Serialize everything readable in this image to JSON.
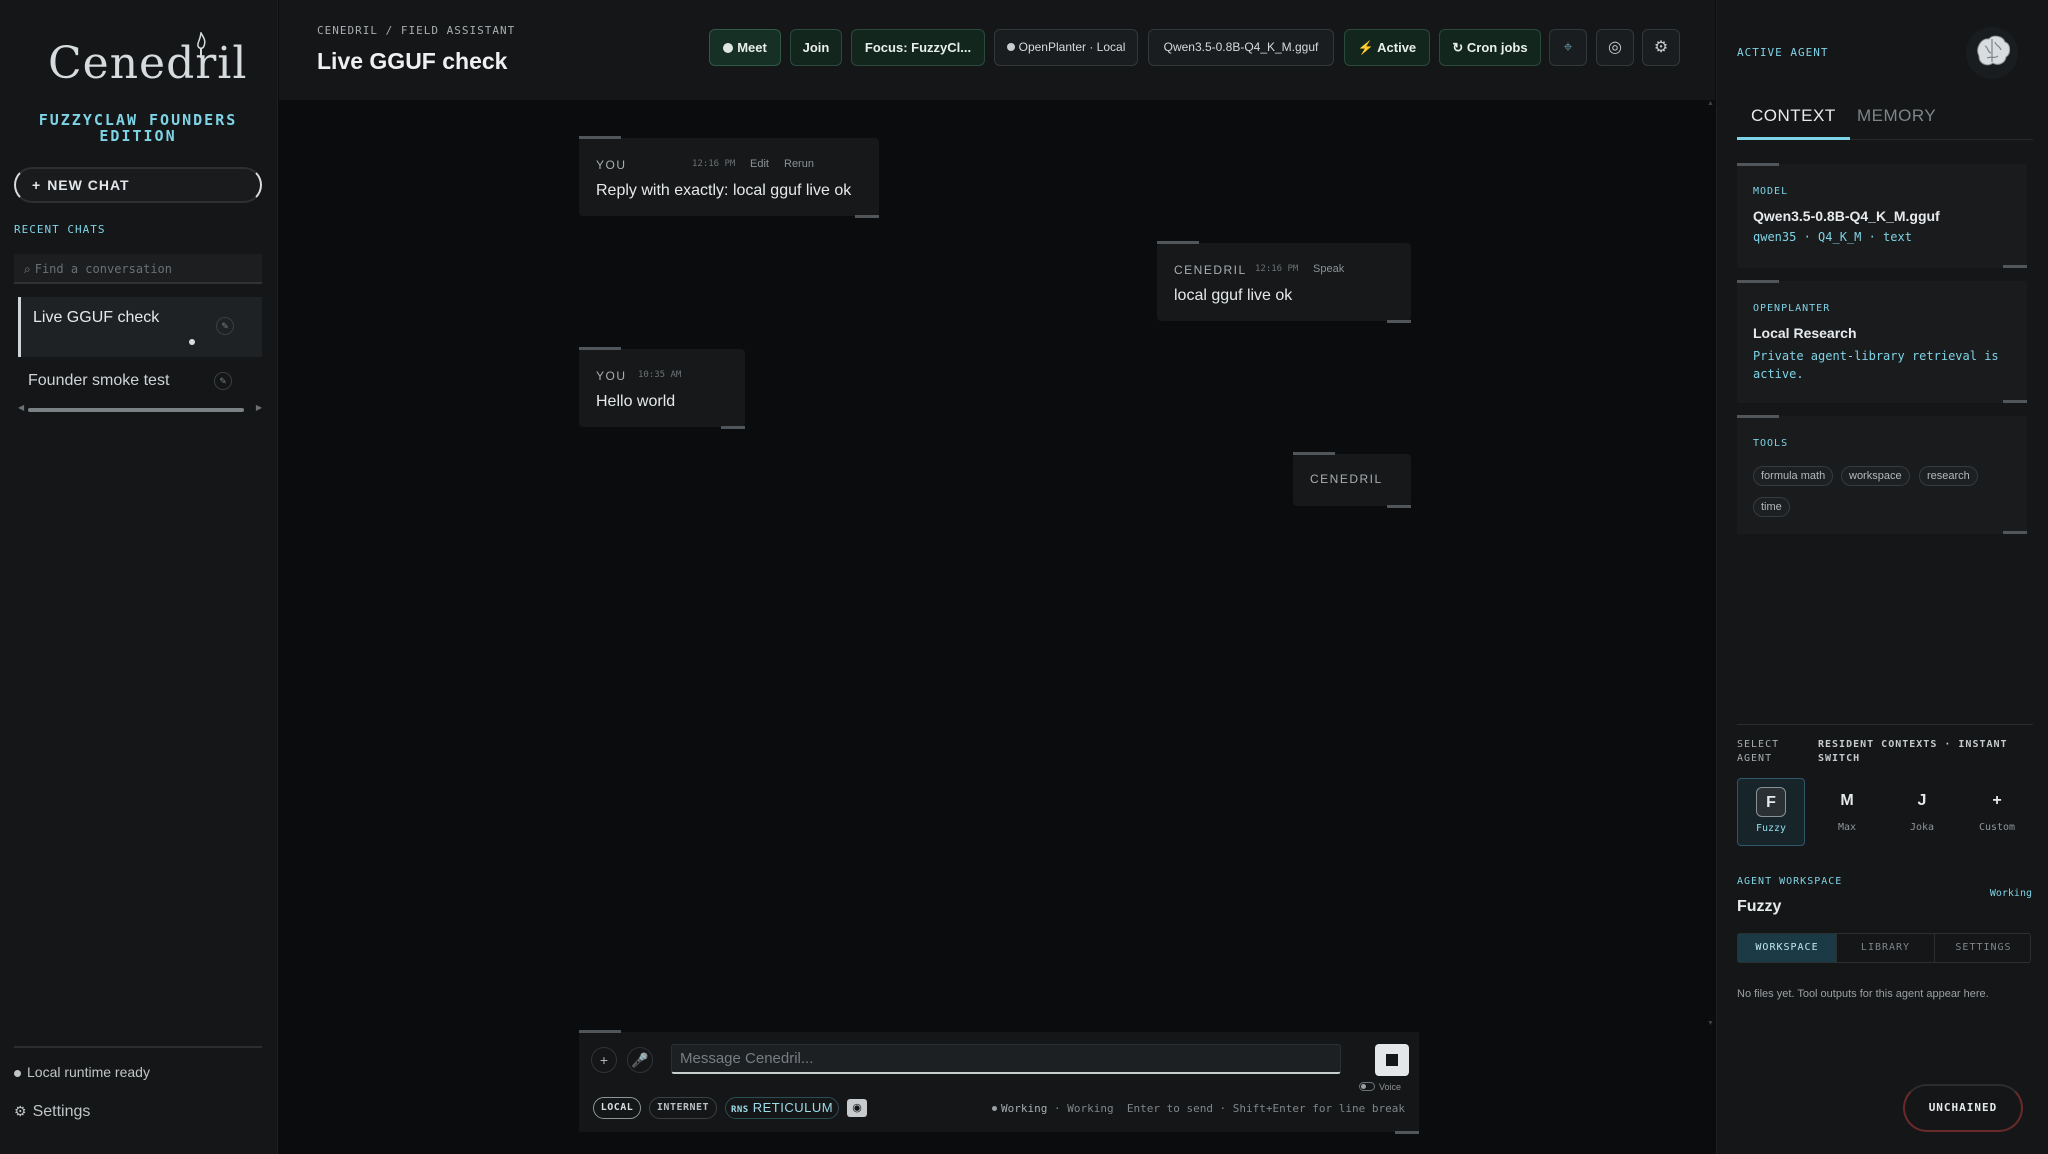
{
  "sidebar": {
    "logo_text": "Cenedril",
    "brand": "FUZZYCLAW FOUNDERS EDITION",
    "new_chat_label": "NEW CHAT",
    "recent_label": "RECENT CHATS",
    "search_placeholder": "Find a conversation",
    "chats": [
      {
        "title": "Live GGUF check"
      },
      {
        "title": "Founder smoke test"
      }
    ],
    "runtime_status": "Local runtime ready",
    "settings_label": "Settings"
  },
  "header": {
    "breadcrumb": "CENEDRIL / FIELD ASSISTANT",
    "title": "Live GGUF check",
    "buttons": {
      "meet": "Meet",
      "join": "Join",
      "focus": "Focus: FuzzyCl...",
      "openplanter": "OpenPlanter · Local",
      "model": "Qwen3.5-0.8B-Q4_K_M.gguf",
      "active": "Active",
      "cron": "Cron jobs"
    }
  },
  "messages": [
    {
      "who": "YOU",
      "time": "12:16 PM",
      "actions": [
        "Edit",
        "Rerun"
      ],
      "text": "Reply with exactly: local gguf live ok"
    },
    {
      "who": "CENEDRIL",
      "time": "12:16 PM",
      "actions": [
        "Speak"
      ],
      "text": "local gguf live ok"
    },
    {
      "who": "YOU",
      "time": "10:35 AM",
      "actions": [],
      "text": "Hello world"
    },
    {
      "who": "CENEDRIL",
      "time": "",
      "actions": [],
      "text": ""
    }
  ],
  "composer": {
    "placeholder": "Message Cenedril...",
    "voice_label": "Voice",
    "chips": {
      "local": "LOCAL",
      "internet": "INTERNET",
      "rns_prefix": "RNS",
      "rns": "RETICULUM"
    },
    "status_working": "Working",
    "status_working2": "Working",
    "hint": "Enter to send · Shift+Enter for line break"
  },
  "right_panel": {
    "active_agent_label": "ACTIVE AGENT",
    "tabs": {
      "context": "CONTEXT",
      "memory": "MEMORY"
    },
    "model_card": {
      "label": "MODEL",
      "name": "Qwen3.5-0.8B-Q4_K_M.gguf",
      "sub": "qwen35 · Q4_K_M · text"
    },
    "openplanter_card": {
      "label": "OPENPLANTER",
      "name": "Local Research",
      "sub": "Private agent-library retrieval is active."
    },
    "tools_card": {
      "label": "TOOLS",
      "tags": [
        "formula math",
        "workspace",
        "research",
        "time"
      ]
    },
    "select_agent_label": "SELECT AGENT",
    "resident_label": "RESIDENT CONTEXTS · INSTANT SWITCH",
    "agents": [
      {
        "initial": "F",
        "name": "Fuzzy"
      },
      {
        "initial": "M",
        "name": "Max"
      },
      {
        "initial": "J",
        "name": "Joka"
      },
      {
        "initial": "+",
        "name": "Custom"
      }
    ],
    "workspace_label": "AGENT WORKSPACE",
    "workspace_status": "Working",
    "workspace_name": "Fuzzy",
    "workspace_tabs": [
      "WORKSPACE",
      "LIBRARY",
      "SETTINGS"
    ],
    "workspace_empty": "No files yet. Tool outputs for this agent appear here.",
    "unchained_label": "UNCHAINED"
  },
  "colors": {
    "accent": "#7fd3e6",
    "background": "#0b0c0d",
    "panel": "#141617",
    "green": "#13261e"
  }
}
